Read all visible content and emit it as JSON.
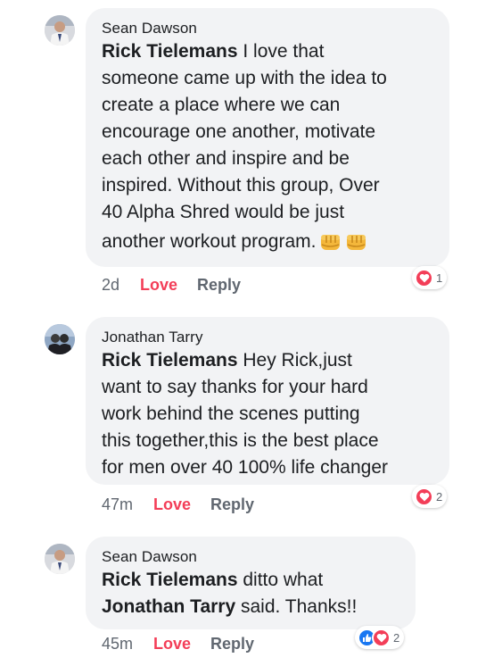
{
  "colors": {
    "bubble": "#f2f3f5",
    "love": "#f33e58",
    "meta": "#606770",
    "like_blue": "#1877f2"
  },
  "comments": [
    {
      "author": "Sean Dawson",
      "mention": "Rick Tielemans",
      "text": " I love that\nsomeone came up with the idea to\ncreate a place where we can\nencourage one another, motivate\neach other and inspire and be\ninspired.  Without this group, Over\n40 Alpha Shred would be just",
      "last_line": "another workout program.",
      "emoji": [
        "oncoming-fist-icon",
        "oncoming-fist-icon"
      ],
      "time": "2d",
      "love_label": "Love",
      "reply_label": "Reply",
      "reactions": [
        "heart-icon"
      ],
      "reaction_count": "1"
    },
    {
      "author": "Jonathan Tarry",
      "mention": "Rick Tielemans",
      "text": " Hey Rick,just\nwant to say thanks for your hard\nwork behind the scenes putting\nthis together,this is the best place\nfor men over 40 100% life changer",
      "time": "47m",
      "love_label": "Love",
      "reply_label": "Reply",
      "reactions": [
        "heart-icon"
      ],
      "reaction_count": "2"
    },
    {
      "author": "Sean Dawson",
      "mention": "Rick Tielemans",
      "text_a": " ditto what",
      "mention2": "Jonathan Tarry",
      "text_b": " said.  Thanks!!",
      "time": "45m",
      "love_label": "Love",
      "reply_label": "Reply",
      "reactions": [
        "like-icon",
        "heart-icon"
      ],
      "reaction_count": "2"
    }
  ]
}
